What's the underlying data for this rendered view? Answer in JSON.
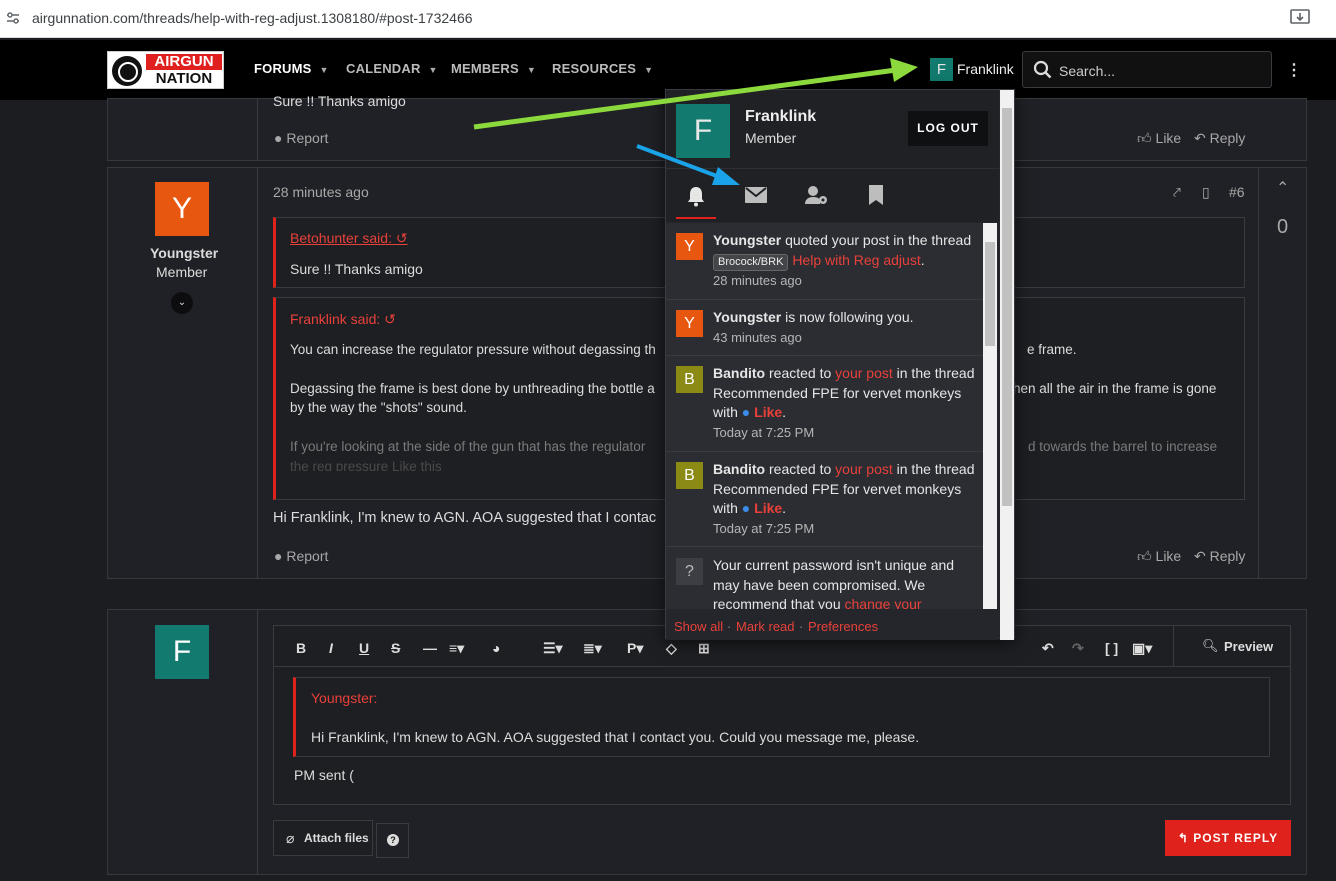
{
  "browser": {
    "url": "airgunnation.com/threads/help-with-reg-adjust.1308180/#post-1732466"
  },
  "nav": {
    "logo_top": "AIRGUN",
    "logo_bottom": "NATION",
    "items": [
      "FORUMS",
      "CALENDAR",
      "MEMBERS",
      "RESOURCES"
    ],
    "user_initial": "F",
    "username": "Franklink",
    "search_placeholder": "Search..."
  },
  "post_top": {
    "text": "Sure !! Thanks amigo",
    "report": "Report",
    "like": "Like",
    "reply": "Reply"
  },
  "post6": {
    "author_initial": "Y",
    "author": "Youngster",
    "role": "Member",
    "time": "28 minutes ago",
    "number": "#6",
    "vote_count": "0",
    "quote1_author": "Betohunter said:",
    "quote1_text": "Sure !! Thanks amigo",
    "quote2_author": "Franklink said:",
    "quote2_line1": "You can increase the regulator pressure without degassing th",
    "quote2_line1_end": "e frame.",
    "quote2_line2": "Degassing the frame is best done by unthreading the bottle a",
    "quote2_line2_end": "hen all the air in the frame is gone",
    "quote2_line3": "by the way the \"shots\" sound.",
    "quote2_line4": "If you're looking at the side of the gun that has the regulator",
    "quote2_line4_end": "d towards the barrel to increase",
    "quote2_line5": "the reg pressure   Like this",
    "body": "Hi Franklink, I'm knew to AGN. AOA suggested that I contac",
    "report": "Report",
    "like": "Like",
    "reply": "Reply"
  },
  "dropdown": {
    "initial": "F",
    "name": "Franklink",
    "role": "Member",
    "logout": "LOG OUT",
    "alerts": [
      {
        "initial": "Y",
        "color": "#e8570f",
        "user": "Youngster",
        "text1": " quoted your post in the thread ",
        "tag": "Brocock/BRK",
        "link": "Help with Reg adjust",
        "text2": ".",
        "time": "28 minutes ago"
      },
      {
        "initial": "Y",
        "color": "#e8570f",
        "user": "Youngster",
        "text1": " is now following you.",
        "time": "43 minutes ago"
      },
      {
        "initial": "B",
        "color": "#8a8a15",
        "user": "Bandito",
        "text1": " reacted to ",
        "link": "your post",
        "text2": " in the thread Recommended FPE for vervet monkeys with ",
        "reaction": "Like",
        "text3": ".",
        "time": "Today at 7:25 PM"
      },
      {
        "initial": "B",
        "color": "#8a8a15",
        "user": "Bandito",
        "text1": " reacted to ",
        "link": "your post",
        "text2": " in the thread Recommended FPE for vervet monkeys with ",
        "reaction": "Like",
        "text3": ".",
        "time": "Today at 7:25 PM"
      },
      {
        "initial": "?",
        "color": "#3d3e44",
        "text1": "Your current password isn't unique and may have been compromised. We recommend that you ",
        "link": "change your"
      }
    ],
    "footer": {
      "show_all": "Show all",
      "mark_read": "Mark read",
      "preferences": "Preferences",
      "sep": "·"
    }
  },
  "editor": {
    "user_initial": "F",
    "preview": "Preview",
    "quote_author": "Youngster:",
    "quote_text": "Hi Franklink, I'm knew to AGN.  AOA  suggested that I  contact you. Could you message me, please.",
    "body": "PM sent (",
    "attach": "Attach files",
    "help": "?",
    "post_reply": "POST REPLY"
  },
  "colors": {
    "accent": "#e0221c",
    "bg": "#1c1d21",
    "arrow_green": "#8bd93c",
    "arrow_blue": "#1aa3e8"
  }
}
